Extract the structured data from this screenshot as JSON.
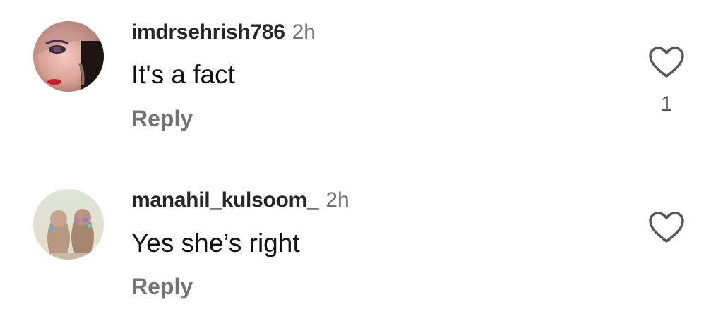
{
  "colors": {
    "username": "#262626",
    "meta": "#737373",
    "text": "#111111",
    "icon_stroke": "#555555"
  },
  "comments": [
    {
      "username": "imdrsehrish786",
      "time": "2h",
      "text": "It's a fact",
      "reply_label": "Reply",
      "like_icon": "heart-outline-icon",
      "like_count": "1"
    },
    {
      "username": "manahil_kulsoom_",
      "time": "2h",
      "text": "Yes she’s right",
      "reply_label": "Reply",
      "like_icon": "heart-outline-icon",
      "like_count": ""
    }
  ]
}
